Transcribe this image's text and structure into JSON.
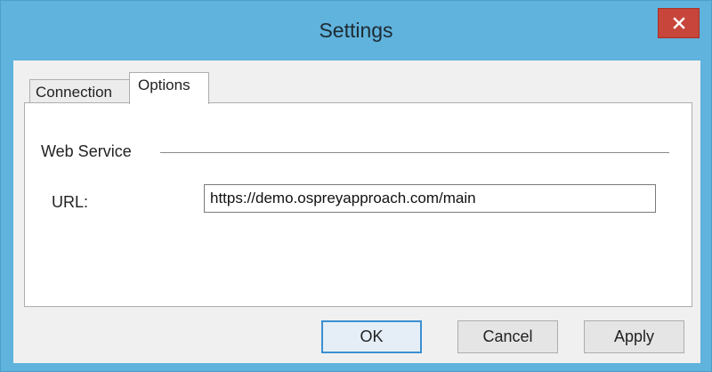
{
  "window": {
    "title": "Settings",
    "close_icon": "close-icon",
    "accent_color": "#5fb3dc",
    "close_color": "#c7453a"
  },
  "tabs": [
    {
      "label": "Connection",
      "selected": false
    },
    {
      "label": "Options",
      "selected": true
    }
  ],
  "options": {
    "group_label": "Web Service",
    "url_label": "URL:",
    "url_value": "https://demo.ospreyapproach.com/main"
  },
  "buttons": {
    "ok": "OK",
    "cancel": "Cancel",
    "apply": "Apply"
  }
}
